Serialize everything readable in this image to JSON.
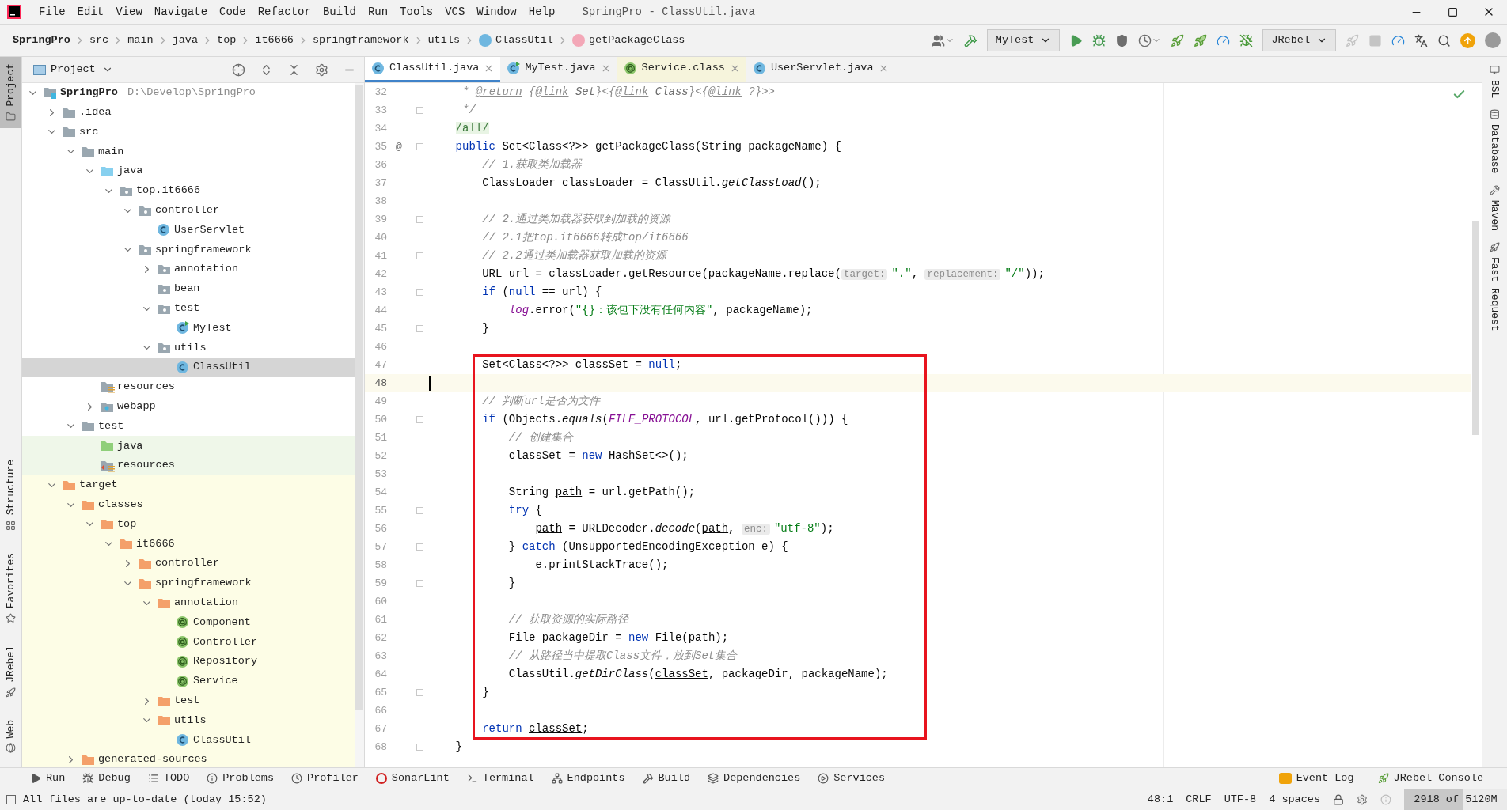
{
  "window": {
    "title": "SpringPro - ClassUtil.java"
  },
  "menu": [
    "File",
    "Edit",
    "View",
    "Navigate",
    "Code",
    "Refactor",
    "Build",
    "Run",
    "Tools",
    "VCS",
    "Window",
    "Help"
  ],
  "breadcrumbs": [
    {
      "label": "SpringPro",
      "kind": "project"
    },
    {
      "label": "src",
      "kind": "dir"
    },
    {
      "label": "main",
      "kind": "dir"
    },
    {
      "label": "java",
      "kind": "dir"
    },
    {
      "label": "top",
      "kind": "dir"
    },
    {
      "label": "it6666",
      "kind": "dir"
    },
    {
      "label": "springframework",
      "kind": "dir"
    },
    {
      "label": "utils",
      "kind": "dir"
    },
    {
      "label": "ClassUtil",
      "kind": "class"
    },
    {
      "label": "getPackageClass",
      "kind": "method"
    }
  ],
  "toolbar": [
    {
      "kind": "user",
      "disabled": false
    },
    {
      "kind": "build",
      "disabled": false
    },
    {
      "kind": "config",
      "label": "MyTest",
      "disabled": false
    },
    {
      "kind": "run",
      "disabled": false
    },
    {
      "kind": "debug",
      "disabled": false
    },
    {
      "kind": "coverage",
      "disabled": false
    },
    {
      "kind": "profile",
      "disabled": false
    },
    {
      "kind": "rebel-run",
      "disabled": false
    },
    {
      "kind": "rebel-debug",
      "disabled": false
    },
    {
      "kind": "gauge",
      "disabled": false
    },
    {
      "kind": "bug-off",
      "disabled": false
    },
    {
      "kind": "config",
      "label": "JRebel",
      "disabled": false
    },
    {
      "kind": "rocket",
      "disabled": true
    },
    {
      "kind": "stop",
      "disabled": true
    },
    {
      "kind": "gauge",
      "disabled": false
    },
    {
      "kind": "translate",
      "disabled": false
    },
    {
      "kind": "search",
      "disabled": false
    },
    {
      "kind": "update",
      "disabled": false
    },
    {
      "kind": "avatar",
      "disabled": false
    }
  ],
  "left_strip": [
    {
      "label": "Project",
      "selected": true,
      "kind": "top"
    },
    {
      "label": "Structure",
      "selected": false,
      "kind": "bottom"
    },
    {
      "label": "Favorites",
      "selected": false,
      "kind": "bottom"
    },
    {
      "label": "JRebel",
      "selected": false,
      "kind": "bottom"
    },
    {
      "label": "Web",
      "selected": false,
      "kind": "bottom"
    }
  ],
  "right_strip": [
    "BSL",
    "Database",
    "Maven",
    "Fast Request"
  ],
  "project_panel": {
    "title": "Project",
    "tree": [
      {
        "label": "SpringPro",
        "kind": "module",
        "note": "D:\\Develop\\SpringPro",
        "expanded": true,
        "selected": false,
        "children": [
          {
            "label": ".idea",
            "kind": "folder",
            "expanded": false,
            "selected": false
          },
          {
            "label": "src",
            "kind": "folder",
            "expanded": true,
            "selected": false,
            "children": [
              {
                "label": "main",
                "kind": "folder",
                "expanded": true,
                "selected": false,
                "children": [
                  {
                    "label": "java",
                    "kind": "source",
                    "expanded": true,
                    "selected": false,
                    "children": [
                      {
                        "label": "top.it6666",
                        "kind": "package",
                        "expanded": true,
                        "selected": false,
                        "children": [
                          {
                            "label": "controller",
                            "kind": "package",
                            "expanded": true,
                            "selected": false,
                            "children": [
                              {
                                "label": "UserServlet",
                                "kind": "class",
                                "selected": false
                              }
                            ]
                          },
                          {
                            "label": "springframework",
                            "kind": "package",
                            "expanded": true,
                            "selected": false,
                            "children": [
                              {
                                "label": "annotation",
                                "kind": "package",
                                "expanded": false,
                                "selected": false
                              },
                              {
                                "label": "bean",
                                "kind": "package",
                                "selected": false
                              },
                              {
                                "label": "test",
                                "kind": "package",
                                "expanded": true,
                                "selected": false,
                                "children": [
                                  {
                                    "label": "MyTest",
                                    "kind": "runnable",
                                    "selected": false
                                  }
                                ]
                              },
                              {
                                "label": "utils",
                                "kind": "package",
                                "expanded": true,
                                "selected": false,
                                "children": [
                                  {
                                    "label": "ClassUtil",
                                    "kind": "class",
                                    "selected": true
                                  }
                                ]
                              }
                            ]
                          }
                        ]
                      }
                    ]
                  },
                  {
                    "label": "resources",
                    "kind": "resources",
                    "selected": false
                  },
                  {
                    "label": "webapp",
                    "kind": "web",
                    "expanded": false,
                    "selected": false
                  }
                ]
              },
              {
                "label": "test",
                "kind": "folder",
                "expanded": true,
                "selected": false,
                "children": [
                  {
                    "label": "java",
                    "kind": "test-source",
                    "test_scope": true,
                    "selected": false
                  },
                  {
                    "label": "resources",
                    "kind": "test-resources",
                    "test_scope": true,
                    "selected": false
                  }
                ]
              }
            ]
          },
          {
            "label": "target",
            "kind": "excluded",
            "excluded": true,
            "expanded": true,
            "selected": false,
            "children": [
              {
                "label": "classes",
                "kind": "excluded",
                "expanded": true,
                "selected": false,
                "children": [
                  {
                    "label": "top",
                    "kind": "excluded",
                    "expanded": true,
                    "selected": false,
                    "children": [
                      {
                        "label": "it6666",
                        "kind": "excluded",
                        "expanded": true,
                        "selected": false,
                        "children": [
                          {
                            "label": "controller",
                            "kind": "excluded",
                            "expanded": false,
                            "selected": false
                          },
                          {
                            "label": "springframework",
                            "kind": "excluded",
                            "expanded": true,
                            "selected": false,
                            "children": [
                              {
                                "label": "annotation",
                                "kind": "excluded",
                                "expanded": true,
                                "selected": false,
                                "children": [
                                  {
                                    "label": "Component",
                                    "kind": "annotation",
                                    "selected": false
                                  },
                                  {
                                    "label": "Controller",
                                    "kind": "annotation",
                                    "selected": false
                                  },
                                  {
                                    "label": "Repository",
                                    "kind": "annotation",
                                    "selected": false
                                  },
                                  {
                                    "label": "Service",
                                    "kind": "annotation",
                                    "selected": false
                                  }
                                ]
                              },
                              {
                                "label": "test",
                                "kind": "excluded",
                                "expanded": false,
                                "selected": false
                              },
                              {
                                "label": "utils",
                                "kind": "excluded",
                                "expanded": true,
                                "selected": false,
                                "children": [
                                  {
                                    "label": "ClassUtil",
                                    "kind": "class",
                                    "selected": false
                                  }
                                ]
                              }
                            ]
                          }
                        ]
                      }
                    ]
                  }
                ]
              },
              {
                "label": "generated-sources",
                "kind": "excluded",
                "expanded": false,
                "selected": false
              }
            ]
          }
        ]
      }
    ]
  },
  "tabs": [
    {
      "label": "ClassUtil.java",
      "kind": "class",
      "selected": true,
      "tinted": false
    },
    {
      "label": "MyTest.java",
      "kind": "runnable",
      "selected": false,
      "tinted": false
    },
    {
      "label": "Service.class",
      "kind": "annotation",
      "selected": false,
      "tinted": true
    },
    {
      "label": "UserServlet.java",
      "kind": "class",
      "selected": false,
      "tinted": false
    }
  ],
  "editor": {
    "blocks": [
      {
        "framed": false,
        "lines": [
          {
            "n": "32",
            "fold": false,
            "tokens": [
              {
                "kind": "comment",
                "text": "     * "
              },
              {
                "kind": "doctag",
                "text": "@return"
              },
              {
                "kind": "comment",
                "text": " {"
              },
              {
                "kind": "doctag",
                "text": "@link"
              },
              {
                "kind": "docref",
                "text": " Set"
              },
              {
                "kind": "comment",
                "text": "}<{"
              },
              {
                "kind": "doctag",
                "text": "@link"
              },
              {
                "kind": "docref",
                "text": " Class"
              },
              {
                "kind": "comment",
                "text": "}<{"
              },
              {
                "kind": "doctag",
                "text": "@link"
              },
              {
                "kind": "comment",
                "text": " ?}>>"
              }
            ]
          },
          {
            "n": "33",
            "fold": true,
            "tokens": [
              {
                "kind": "comment",
                "text": "     */"
              }
            ]
          },
          {
            "n": "34",
            "fold": false,
            "tokens": [
              {
                "kind": "label",
                "text": "    /all/"
              }
            ]
          },
          {
            "n": "35",
            "fold": true,
            "mark": "@",
            "tokens": [
              {
                "kind": "keyword",
                "text": "    public"
              },
              {
                "kind": "plain",
                "text": " Set<Class<?>> getPackageClass(String packageName) {"
              }
            ]
          },
          {
            "n": "36",
            "fold": false,
            "tokens": [
              {
                "kind": "comment",
                "text": "        // 1.获取类加载器"
              }
            ]
          },
          {
            "n": "37",
            "fold": false,
            "tokens": [
              {
                "kind": "plain",
                "text": "        ClassLoader classLoader = ClassUtil."
              },
              {
                "kind": "call",
                "text": "getClassLoad"
              },
              {
                "kind": "plain",
                "text": "();"
              }
            ]
          },
          {
            "n": "38",
            "fold": false
          },
          {
            "n": "39",
            "fold": true,
            "tokens": [
              {
                "kind": "comment",
                "text": "        // 2.通过类加载器获取到加载的资源"
              }
            ]
          },
          {
            "n": "40",
            "fold": false,
            "tokens": [
              {
                "kind": "comment",
                "text": "        // 2.1把top.it6666转成top/it6666"
              }
            ]
          },
          {
            "n": "41",
            "fold": true,
            "tokens": [
              {
                "kind": "comment",
                "text": "        // 2.2通过类加载器获取加载的资源"
              }
            ]
          },
          {
            "n": "42",
            "fold": false,
            "tokens": [
              {
                "kind": "plain",
                "text": "        URL url = classLoader.getResource(packageName.replace("
              },
              {
                "kind": "hint",
                "text": "target:"
              },
              {
                "kind": "string",
                "text": "\".\""
              },
              {
                "kind": "plain",
                "text": ", "
              },
              {
                "kind": "hint",
                "text": "replacement:"
              },
              {
                "kind": "string",
                "text": "\"/\""
              },
              {
                "kind": "plain",
                "text": "));"
              }
            ]
          },
          {
            "n": "43",
            "fold": true,
            "tokens": [
              {
                "kind": "keyword",
                "text": "        if"
              },
              {
                "kind": "plain",
                "text": " ("
              },
              {
                "kind": "keyword",
                "text": "null"
              },
              {
                "kind": "plain",
                "text": " == url) {"
              }
            ]
          },
          {
            "n": "44",
            "fold": false,
            "tokens": [
              {
                "kind": "field",
                "text": "            log"
              },
              {
                "kind": "plain",
                "text": ".error("
              },
              {
                "kind": "string",
                "text": "\"{}：该包下没有任何内容\""
              },
              {
                "kind": "plain",
                "text": ", packageName);"
              }
            ]
          },
          {
            "n": "45",
            "fold": true,
            "tokens": [
              {
                "kind": "plain",
                "text": "        }"
              }
            ]
          },
          {
            "n": "46",
            "fold": false
          }
        ]
      },
      {
        "framed": true,
        "lines": [
          {
            "n": "47",
            "fold": false,
            "tokens": [
              {
                "kind": "plain",
                "text": "        Set<Class<?>> "
              },
              {
                "kind": "var",
                "text": "classSet"
              },
              {
                "kind": "plain",
                "text": " = "
              },
              {
                "kind": "keyword",
                "text": "null"
              },
              {
                "kind": "plain",
                "text": ";"
              }
            ]
          },
          {
            "n": "48",
            "fold": false,
            "current": true
          },
          {
            "n": "49",
            "fold": false,
            "tokens": [
              {
                "kind": "comment",
                "text": "        // 判断url是否为文件"
              }
            ]
          },
          {
            "n": "50",
            "fold": true,
            "tokens": [
              {
                "kind": "keyword",
                "text": "        if"
              },
              {
                "kind": "plain",
                "text": " (Objects."
              },
              {
                "kind": "call",
                "text": "equals"
              },
              {
                "kind": "plain",
                "text": "("
              },
              {
                "kind": "field",
                "text": "FILE_PROTOCOL"
              },
              {
                "kind": "plain",
                "text": ", url.getProtocol())) {"
              }
            ]
          },
          {
            "n": "51",
            "fold": false,
            "tokens": [
              {
                "kind": "comment",
                "text": "            // 创建集合"
              }
            ]
          },
          {
            "n": "52",
            "fold": false,
            "tokens": [
              {
                "kind": "var",
                "text": "            classSet"
              },
              {
                "kind": "plain",
                "text": " = "
              },
              {
                "kind": "keyword",
                "text": "new"
              },
              {
                "kind": "plain",
                "text": " HashSet<>();"
              }
            ]
          },
          {
            "n": "53",
            "fold": false
          },
          {
            "n": "54",
            "fold": false,
            "tokens": [
              {
                "kind": "plain",
                "text": "            String "
              },
              {
                "kind": "var",
                "text": "path"
              },
              {
                "kind": "plain",
                "text": " = url.getPath();"
              }
            ]
          },
          {
            "n": "55",
            "fold": true,
            "tokens": [
              {
                "kind": "keyword",
                "text": "            try"
              },
              {
                "kind": "plain",
                "text": " {"
              }
            ]
          },
          {
            "n": "56",
            "fold": false,
            "tokens": [
              {
                "kind": "var",
                "text": "                path"
              },
              {
                "kind": "plain",
                "text": " = URLDecoder."
              },
              {
                "kind": "call",
                "text": "decode"
              },
              {
                "kind": "plain",
                "text": "("
              },
              {
                "kind": "var",
                "text": "path"
              },
              {
                "kind": "plain",
                "text": ", "
              },
              {
                "kind": "hint",
                "text": "enc:"
              },
              {
                "kind": "string",
                "text": "\"utf-8\""
              },
              {
                "kind": "plain",
                "text": ");"
              }
            ]
          },
          {
            "n": "57",
            "fold": true,
            "tokens": [
              {
                "kind": "plain",
                "text": "            } "
              },
              {
                "kind": "keyword",
                "text": "catch"
              },
              {
                "kind": "plain",
                "text": " (UnsupportedEncodingException e) {"
              }
            ]
          },
          {
            "n": "58",
            "fold": false,
            "tokens": [
              {
                "kind": "plain",
                "text": "                e.printStackTrace();"
              }
            ]
          },
          {
            "n": "59",
            "fold": true,
            "tokens": [
              {
                "kind": "plain",
                "text": "            }"
              }
            ]
          },
          {
            "n": "60",
            "fold": false
          },
          {
            "n": "61",
            "fold": false,
            "tokens": [
              {
                "kind": "comment",
                "text": "            // 获取资源的实际路径"
              }
            ]
          },
          {
            "n": "62",
            "fold": false,
            "tokens": [
              {
                "kind": "plain",
                "text": "            File packageDir = "
              },
              {
                "kind": "keyword",
                "text": "new"
              },
              {
                "kind": "plain",
                "text": " File("
              },
              {
                "kind": "var",
                "text": "path"
              },
              {
                "kind": "plain",
                "text": ");"
              }
            ]
          },
          {
            "n": "63",
            "fold": false,
            "tokens": [
              {
                "kind": "comment",
                "text": "            // 从路径当中提取Class文件，放到Set集合"
              }
            ]
          },
          {
            "n": "64",
            "fold": false,
            "tokens": [
              {
                "kind": "plain",
                "text": "            ClassUtil."
              },
              {
                "kind": "call",
                "text": "getDirClass"
              },
              {
                "kind": "plain",
                "text": "("
              },
              {
                "kind": "var",
                "text": "classSet"
              },
              {
                "kind": "plain",
                "text": ", packageDir, packageName);"
              }
            ]
          },
          {
            "n": "65",
            "fold": true,
            "tokens": [
              {
                "kind": "plain",
                "text": "        }"
              }
            ]
          },
          {
            "n": "66",
            "fold": false
          },
          {
            "n": "67",
            "fold": false,
            "tokens": [
              {
                "kind": "keyword",
                "text": "        return"
              },
              {
                "kind": "var",
                "text": " classSet"
              },
              {
                "kind": "plain",
                "text": ";"
              }
            ]
          }
        ]
      },
      {
        "framed": false,
        "lines": [
          {
            "n": "68",
            "fold": true,
            "tokens": [
              {
                "kind": "plain",
                "text": "    }"
              }
            ]
          }
        ]
      }
    ]
  },
  "tool_bar": {
    "left": [
      {
        "label": "Run",
        "kind": "run"
      },
      {
        "label": "Debug",
        "kind": "debug"
      },
      {
        "label": "TODO",
        "kind": "list"
      },
      {
        "label": "Problems",
        "kind": "info"
      },
      {
        "label": "Profiler",
        "kind": "profiler"
      },
      {
        "label": "SonarLint",
        "kind": "sonar"
      },
      {
        "label": "Terminal",
        "kind": "terminal"
      },
      {
        "label": "Endpoints",
        "kind": "endpoints"
      },
      {
        "label": "Build",
        "kind": "build"
      },
      {
        "label": "Dependencies",
        "kind": "layers"
      },
      {
        "label": "Services",
        "kind": "services"
      }
    ],
    "right": [
      {
        "label": "Event Log",
        "kind": "event"
      },
      {
        "label": "JRebel Console",
        "kind": "rebel"
      }
    ]
  },
  "status_bar": {
    "message": "All files are up-to-date (today 15:52)",
    "position": "48:1",
    "line_ending": "CRLF",
    "encoding": "UTF-8",
    "indent": "4 spaces",
    "memory": {
      "text": "2918 of 5120M",
      "level": 0.57
    }
  }
}
